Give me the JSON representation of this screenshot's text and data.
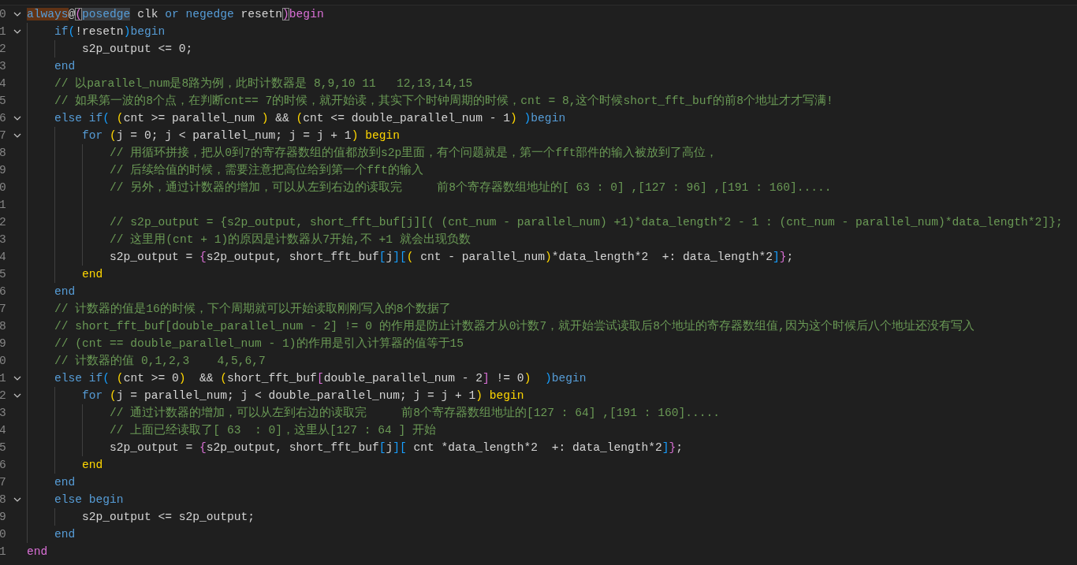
{
  "editor": {
    "lines": [
      {
        "number": "0",
        "expanded": true,
        "tokens": [
          {
            "text": "always",
            "kind": "keyword",
            "highlighted": true
          },
          {
            "text": "@",
            "kind": "text"
          },
          {
            "text": "(",
            "kind": "br2",
            "matched": true
          },
          {
            "text": "posedge",
            "kind": "keyword",
            "selected": true
          },
          {
            "text": " clk ",
            "kind": "text"
          },
          {
            "text": "or ",
            "kind": "keyword"
          },
          {
            "text": "negedge",
            "kind": "keyword"
          },
          {
            "text": " resetn",
            "kind": "text"
          },
          {
            "text": ")",
            "kind": "br2",
            "matched": true
          },
          {
            "text": "begin",
            "kind": "br2"
          }
        ]
      },
      {
        "number": "1",
        "expanded": true,
        "tokens": [
          {
            "text": "    if",
            "kind": "keyword"
          },
          {
            "text": "(",
            "kind": "br3"
          },
          {
            "text": "!resetn",
            "kind": "text"
          },
          {
            "text": ")",
            "kind": "br3"
          },
          {
            "text": "begin",
            "kind": "keyword"
          }
        ]
      },
      {
        "number": "2",
        "tokens": [
          {
            "text": "        s2p_output <= 0;",
            "kind": "text"
          }
        ]
      },
      {
        "number": "3",
        "tokens": [
          {
            "text": "    end",
            "kind": "keyword"
          }
        ]
      },
      {
        "number": "4",
        "tokens": [
          {
            "text": "    // 以parallel_num是8路为例，此时计数器是 8,9,10 11   12,13,14,15",
            "kind": "comment"
          }
        ]
      },
      {
        "number": "5",
        "tokens": [
          {
            "text": "    // 如果第一波的8个点，在判断cnt== 7的时候，就开始读，其实下个时钟周期的时候，cnt = 8,这个时候short_fft_buf的前8个地址才才写满!",
            "kind": "comment"
          }
        ]
      },
      {
        "number": "6",
        "expanded": true,
        "tokens": [
          {
            "text": "    else ",
            "kind": "keyword"
          },
          {
            "text": "if",
            "kind": "keyword"
          },
          {
            "text": "(",
            "kind": "br3"
          },
          {
            "text": " (",
            "kind": "br1"
          },
          {
            "text": "cnt >= parallel_num ",
            "kind": "text"
          },
          {
            "text": ")",
            "kind": "br1"
          },
          {
            "text": " && ",
            "kind": "text"
          },
          {
            "text": "(",
            "kind": "br1"
          },
          {
            "text": "cnt <= double_parallel_num - 1",
            "kind": "text"
          },
          {
            "text": ")",
            "kind": "br1"
          },
          {
            "text": " )",
            "kind": "br3"
          },
          {
            "text": "begin",
            "kind": "keyword"
          }
        ]
      },
      {
        "number": "7",
        "expanded": true,
        "tokens": [
          {
            "text": "        for",
            "kind": "keyword"
          },
          {
            "text": " (",
            "kind": "br1"
          },
          {
            "text": "j = 0; j < parallel_num; j = j + 1",
            "kind": "text"
          },
          {
            "text": ")",
            "kind": "br1"
          },
          {
            "text": " begin",
            "kind": "br1"
          }
        ]
      },
      {
        "number": "8",
        "tokens": [
          {
            "text": "            // 用循环拼接，把从0到7的寄存器数组的值都放到s2p里面，有个问题就是，第一个fft部件的输入被放到了高位，",
            "kind": "comment"
          }
        ]
      },
      {
        "number": "9",
        "tokens": [
          {
            "text": "            // 后续给值的时候，需要注意把高位给到第一个fft的输入",
            "kind": "comment"
          }
        ]
      },
      {
        "number": "0",
        "tokens": [
          {
            "text": "            // 另外，通过计数器的增加，可以从左到右边的读取完     前8个寄存器数组地址的[ 63 : 0] ,[127 : 96] ,[191 : 160].....",
            "kind": "comment"
          }
        ]
      },
      {
        "number": "1"
      },
      {
        "number": "2",
        "tokens": [
          {
            "text": "            // s2p_output = {s2p_output, short_fft_buf[j][( (cnt_num - parallel_num) +1)*data_length*2 - 1 : (cnt_num - parallel_num)*data_length*2]};",
            "kind": "comment"
          }
        ]
      },
      {
        "number": "3",
        "tokens": [
          {
            "text": "            // 这里用(cnt + 1)的原因是计数器从7开始,不 +1 就会出现负数",
            "kind": "comment"
          }
        ]
      },
      {
        "number": "4",
        "tokens": [
          {
            "text": "            s2p_output = ",
            "kind": "text"
          },
          {
            "text": "{",
            "kind": "br2"
          },
          {
            "text": "s2p_output, short_fft_buf",
            "kind": "text"
          },
          {
            "text": "[",
            "kind": "br3"
          },
          {
            "text": "j",
            "kind": "text"
          },
          {
            "text": "]",
            "kind": "br3"
          },
          {
            "text": "[",
            "kind": "br3"
          },
          {
            "text": "(",
            "kind": "br1"
          },
          {
            "text": " cnt - parallel_num",
            "kind": "text"
          },
          {
            "text": ")",
            "kind": "br1"
          },
          {
            "text": "*data_length*2  +: data_length*2",
            "kind": "text"
          },
          {
            "text": "]",
            "kind": "br3"
          },
          {
            "text": "}",
            "kind": "br2"
          },
          {
            "text": ";",
            "kind": "text"
          }
        ]
      },
      {
        "number": "5",
        "tokens": [
          {
            "text": "        end",
            "kind": "br1"
          }
        ]
      },
      {
        "number": "6",
        "tokens": [
          {
            "text": "    end",
            "kind": "keyword"
          }
        ]
      },
      {
        "number": "7",
        "tokens": [
          {
            "text": "    // 计数器的值是16的时候，下个周期就可以开始读取刚刚写入的8个数据了",
            "kind": "comment"
          }
        ]
      },
      {
        "number": "8",
        "tokens": [
          {
            "text": "    // short_fft_buf[double_parallel_num - 2] != 0 的作用是防止计数器才从0计数7，就开始尝试读取后8个地址的寄存器数组值,因为这个时候后八个地址还没有写入",
            "kind": "comment"
          }
        ]
      },
      {
        "number": "9",
        "tokens": [
          {
            "text": "    // (cnt == double_parallel_num - 1)的作用是引入计算器的值等于15",
            "kind": "comment"
          }
        ]
      },
      {
        "number": "0",
        "tokens": [
          {
            "text": "    // 计数器的值 0,1,2,3    4,5,6,7",
            "kind": "comment"
          }
        ]
      },
      {
        "number": "1",
        "expanded": true,
        "tokens": [
          {
            "text": "    else ",
            "kind": "keyword"
          },
          {
            "text": "if",
            "kind": "keyword"
          },
          {
            "text": "(",
            "kind": "br3"
          },
          {
            "text": " (",
            "kind": "br1"
          },
          {
            "text": "cnt >= 0",
            "kind": "text"
          },
          {
            "text": ")",
            "kind": "br1"
          },
          {
            "text": "  && ",
            "kind": "text"
          },
          {
            "text": "(",
            "kind": "br1"
          },
          {
            "text": "short_fft_buf",
            "kind": "text"
          },
          {
            "text": "[",
            "kind": "br2"
          },
          {
            "text": "double_parallel_num - 2",
            "kind": "text"
          },
          {
            "text": "]",
            "kind": "br2"
          },
          {
            "text": " != 0",
            "kind": "text"
          },
          {
            "text": ")",
            "kind": "br1"
          },
          {
            "text": "  )",
            "kind": "br3"
          },
          {
            "text": "begin",
            "kind": "keyword"
          }
        ]
      },
      {
        "number": "2",
        "expanded": true,
        "tokens": [
          {
            "text": "        for",
            "kind": "keyword"
          },
          {
            "text": " (",
            "kind": "br1"
          },
          {
            "text": "j = parallel_num; j < double_parallel_num; j = j + 1",
            "kind": "text"
          },
          {
            "text": ")",
            "kind": "br1"
          },
          {
            "text": " begin",
            "kind": "br1"
          }
        ]
      },
      {
        "number": "3",
        "tokens": [
          {
            "text": "            // 通过计数器的增加，可以从左到右边的读取完     前8个寄存器数组地址的[127 : 64] ,[191 : 160].....",
            "kind": "comment"
          }
        ]
      },
      {
        "number": "4",
        "tokens": [
          {
            "text": "            // 上面已经读取了[ 63  : 0]，这里从[127 : 64 ] 开始",
            "kind": "comment"
          }
        ]
      },
      {
        "number": "5",
        "tokens": [
          {
            "text": "            s2p_output = ",
            "kind": "text"
          },
          {
            "text": "{",
            "kind": "br2"
          },
          {
            "text": "s2p_output, short_fft_buf",
            "kind": "text"
          },
          {
            "text": "[",
            "kind": "br3"
          },
          {
            "text": "j",
            "kind": "text"
          },
          {
            "text": "]",
            "kind": "br3"
          },
          {
            "text": "[",
            "kind": "br3"
          },
          {
            "text": " cnt *data_length*2  +: data_length*2",
            "kind": "text"
          },
          {
            "text": "]",
            "kind": "br3"
          },
          {
            "text": "}",
            "kind": "br2"
          },
          {
            "text": ";",
            "kind": "text"
          }
        ]
      },
      {
        "number": "6",
        "tokens": [
          {
            "text": "        end",
            "kind": "br1"
          }
        ]
      },
      {
        "number": "7",
        "tokens": [
          {
            "text": "    end",
            "kind": "keyword"
          }
        ]
      },
      {
        "number": "8",
        "expanded": true,
        "tokens": [
          {
            "text": "    else ",
            "kind": "keyword"
          },
          {
            "text": "begin",
            "kind": "keyword"
          }
        ]
      },
      {
        "number": "9",
        "tokens": [
          {
            "text": "        s2p_output <= s2p_output;",
            "kind": "text"
          }
        ]
      },
      {
        "number": "0",
        "tokens": [
          {
            "text": "    end",
            "kind": "keyword"
          }
        ]
      },
      {
        "number": "1",
        "tokens": [
          {
            "text": "end",
            "kind": "br2"
          }
        ]
      }
    ]
  }
}
